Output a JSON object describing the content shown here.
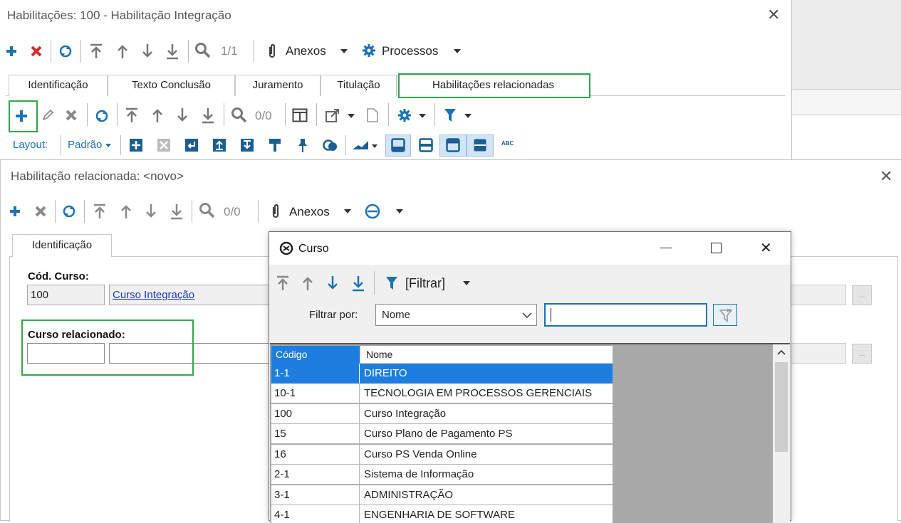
{
  "main_window": {
    "title": "Habilitações: 100 - Habilitação Integração",
    "toolbar": {
      "page_indicator": "1/1",
      "attachments_label": "Anexos",
      "processes_label": "Processos"
    },
    "tabs": [
      "Identificação",
      "Texto Conclusão",
      "Juramento",
      "Titulação",
      "Habilitações relacionadas"
    ],
    "sub_toolbar": {
      "page_indicator": "0/0",
      "layout_label": "Layout:",
      "layout_value": "Padrão",
      "abc_label": "ABC"
    }
  },
  "related_window": {
    "title": "Habilitação relacionada: <novo>",
    "toolbar": {
      "page_indicator": "0/0",
      "attachments_label": "Anexos"
    },
    "tab": "Identificação",
    "fields": {
      "course_code_label": "Cód. Curso:",
      "course_code_value": "100",
      "course_name_link": "Curso Integração",
      "related_course_label": "Curso relacionado:",
      "related_code_value": "",
      "related_name_value": ""
    },
    "ellipsis": "..."
  },
  "lookup_dialog": {
    "title": "Curso",
    "filter_button_label": "[Filtrar]",
    "filter_by_label": "Filtrar por:",
    "filter_by_value": "Nome",
    "filter_text": "",
    "grid": {
      "columns": [
        "Código",
        "Nome"
      ],
      "rows": [
        {
          "code": "1-1",
          "name": "DIREITO"
        },
        {
          "code": "10-1",
          "name": "TECNOLOGIA EM PROCESSOS GERENCIAIS"
        },
        {
          "code": "100",
          "name": "Curso Integração"
        },
        {
          "code": "15",
          "name": "Curso Plano de Pagamento PS"
        },
        {
          "code": "16",
          "name": "Curso PS Venda Online"
        },
        {
          "code": "2-1",
          "name": "Sistema de Informação"
        },
        {
          "code": "3-1",
          "name": "ADMINISTRAÇÃO"
        },
        {
          "code": "4-1",
          "name": "ENGENHARIA DE SOFTWARE"
        }
      ]
    }
  },
  "colors": {
    "accent_blue": "#1e7ee0",
    "highlight_green": "#2ea84a",
    "icon_blue": "#1a73b5",
    "delete_red": "#d22b2b"
  }
}
